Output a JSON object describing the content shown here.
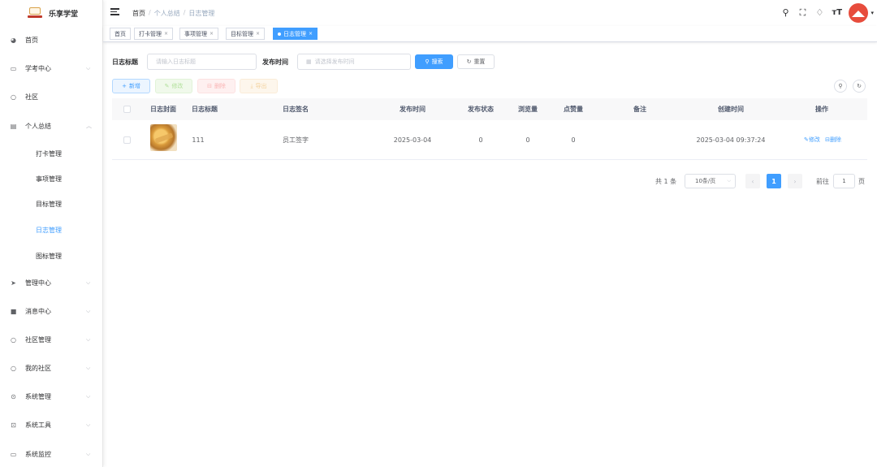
{
  "app": {
    "title": "乐享学堂"
  },
  "sidebar": {
    "items": [
      {
        "label": "首页",
        "icon": "dashboard-icon",
        "arrow": ""
      },
      {
        "label": "学考中心",
        "icon": "monitor-icon",
        "arrow": "⌵"
      },
      {
        "label": "社区",
        "icon": "circle-icon",
        "arrow": ""
      },
      {
        "label": "个人总结",
        "icon": "document-icon",
        "arrow": "︿"
      },
      {
        "label": "管理中心",
        "icon": "send-icon",
        "arrow": "⌵"
      },
      {
        "label": "消息中心",
        "icon": "message-icon",
        "arrow": "⌵"
      },
      {
        "label": "社区管理",
        "icon": "circle-icon",
        "arrow": "⌵"
      },
      {
        "label": "我的社区",
        "icon": "circle-icon",
        "arrow": "⌵"
      },
      {
        "label": "系统管理",
        "icon": "settings-icon",
        "arrow": "⌵"
      },
      {
        "label": "系统工具",
        "icon": "tool-icon",
        "arrow": "⌵"
      },
      {
        "label": "系统监控",
        "icon": "monitor-icon",
        "arrow": "⌵"
      }
    ],
    "subitems": [
      "打卡管理",
      "事项管理",
      "目标管理",
      "日志管理",
      "图标管理"
    ]
  },
  "header": {
    "breadcrumb": [
      "首页",
      "个人总结",
      "日志管理"
    ],
    "separator": "/",
    "icons": [
      "search-icon",
      "fullscreen-icon",
      "bell-icon",
      "font-size-icon"
    ]
  },
  "tags": [
    {
      "label": "首页",
      "closable": false
    },
    {
      "label": "打卡管理",
      "closable": true
    },
    {
      "label": "事项管理",
      "closable": true
    },
    {
      "label": "目标管理",
      "closable": true
    },
    {
      "label": "日志管理",
      "closable": true,
      "active": true
    }
  ],
  "search": {
    "title_label": "日志标题",
    "title_placeholder": "请输入日志标题",
    "time_label": "发布时间",
    "time_placeholder": "请选择发布时间",
    "search_btn": "搜索",
    "reset_btn": "重置"
  },
  "toolbar": {
    "add": "新增",
    "edit": "修改",
    "delete": "删除",
    "export": "导出"
  },
  "table": {
    "headers": [
      "日志封面",
      "日志标题",
      "日志签名",
      "发布时间",
      "发布状态",
      "浏览量",
      "点赞量",
      "备注",
      "创建时间",
      "操作"
    ],
    "rows": [
      {
        "title": "111",
        "signature": "员工签字",
        "publish_time": "2025-03-04",
        "status": "0",
        "views": "0",
        "likes": "0",
        "remark": "",
        "created": "2025-03-04 09:37:24",
        "edit": "修改",
        "delete": "删除"
      }
    ]
  },
  "pagination": {
    "total": "共 1 条",
    "page_size": "10条/页",
    "current": "1",
    "goto_prefix": "前往",
    "goto_value": "1",
    "goto_suffix": "页"
  },
  "colors": {
    "primary": "#409eff",
    "avatar": "#e74c3c"
  }
}
